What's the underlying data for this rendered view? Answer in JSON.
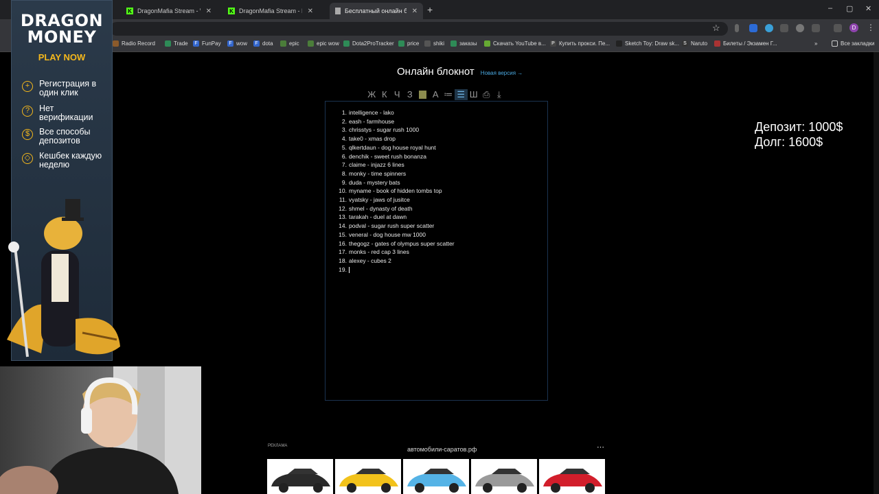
{
  "browser": {
    "tabs": [
      {
        "label": "DragonMafia Stream - Watch L",
        "icon": "kick-icon"
      },
      {
        "label": "DragonMafia Stream - Kick",
        "icon": "kick-icon"
      },
      {
        "label": "Бесплатный онлайн блокнот д",
        "icon": "document-icon",
        "active": true
      }
    ],
    "new_tab": "+",
    "window_controls": [
      "–",
      "▢",
      "✕"
    ],
    "bookmarks": [
      {
        "label": "Radio Record",
        "color": "#8b5a2b"
      },
      {
        "label": "Trade",
        "color": "#2e8b57"
      },
      {
        "label": "FunPay",
        "color": "#3366cc",
        "glyph": "F"
      },
      {
        "label": "wow",
        "color": "#3366cc",
        "glyph": "F"
      },
      {
        "label": "dota",
        "color": "#3366cc",
        "glyph": "F"
      },
      {
        "label": "epic",
        "color": "#4b7d3a"
      },
      {
        "label": "epic wow",
        "color": "#4b7d3a"
      },
      {
        "label": "Dota2ProTracker",
        "color": "#2e8b57"
      },
      {
        "label": "price",
        "color": "#2e8b57"
      },
      {
        "label": "shiki",
        "color": "#555555"
      },
      {
        "label": "заказы",
        "color": "#2e8b57"
      },
      {
        "label": "Скачать YouTube в...",
        "color": "#66aa33"
      },
      {
        "label": "Купить прокси. Пе...",
        "color": "#444444",
        "glyph": "P"
      },
      {
        "label": "Sketch Toy: Draw sk...",
        "color": "#222222"
      },
      {
        "label": "Naruto",
        "color": "#333333",
        "glyph": "S"
      },
      {
        "label": "Билеты / Экзамен Г...",
        "color": "#aa3333"
      }
    ],
    "all_bookmarks": "Все закладки",
    "profile_initial": "D"
  },
  "left_ad": {
    "brand_line1": "DRAGON",
    "brand_line2": "MONEY",
    "cta": "PLAY NOW",
    "accent": "#f5b81c",
    "features": [
      {
        "icon": "plus-circle-icon",
        "glyph": "+",
        "text": "Регистрация в один клик"
      },
      {
        "icon": "question-circle-icon",
        "glyph": "?",
        "text": "Нет верификации"
      },
      {
        "icon": "coin-icon",
        "glyph": "$",
        "text": "Все способы депозитов"
      },
      {
        "icon": "cashback-icon",
        "glyph": "◇",
        "text": "Кешбек каждую неделю"
      }
    ]
  },
  "notepad": {
    "title": "Онлайн блокнот",
    "new_version_link": "Новая версия →",
    "toolbar": [
      {
        "glyph": "Ж",
        "name": "bold-button"
      },
      {
        "glyph": "К",
        "name": "italic-button"
      },
      {
        "glyph": "Ч",
        "name": "underline-button"
      },
      {
        "glyph": "З",
        "name": "strikethrough-button"
      },
      {
        "glyph": "",
        "name": "highlight-color-button"
      },
      {
        "glyph": "A",
        "name": "text-color-button"
      },
      {
        "glyph": "≔",
        "name": "bullet-list-button"
      },
      {
        "glyph": "☰",
        "name": "numbered-list-button",
        "active": true
      },
      {
        "glyph": "Ш",
        "name": "table-button"
      },
      {
        "glyph": "⎙",
        "name": "print-button"
      },
      {
        "glyph": "⤓",
        "name": "download-button"
      }
    ],
    "lines": [
      "intelligence - lako",
      "eash - farmhouse",
      "chrisstys - sugar rush 1000",
      "take0 - xmas drop",
      "qlkertdaun - dog house royal hunt",
      "denchik - sweet rush bonanza",
      "claime - injazz 6 lines",
      "monky - time spinners",
      "duda - mystery bats",
      "myname - book of hidden tombs top",
      "vyatsky - jaws of jusitce",
      "shmel - dynasty of death",
      "tarakah - duel at dawn",
      "podval - sugar rush super scatter",
      "veneral - dog house mw 1000",
      "thegogz - gates of olympus super scatter",
      "monks - red cap 3 lines",
      "alexey - cubes 2",
      ""
    ]
  },
  "overlay": {
    "deposit": "Депозит: 1000$",
    "debt": "Долг: 1600$"
  },
  "bottom_ad": {
    "label": "РЕКЛАМА",
    "site": "автомобили-саратов.рф",
    "more": "⋯",
    "cars": [
      "#2a2a2a",
      "#f2c21b",
      "#55b3e6",
      "#9a9a9a",
      "#d21e2b"
    ]
  }
}
